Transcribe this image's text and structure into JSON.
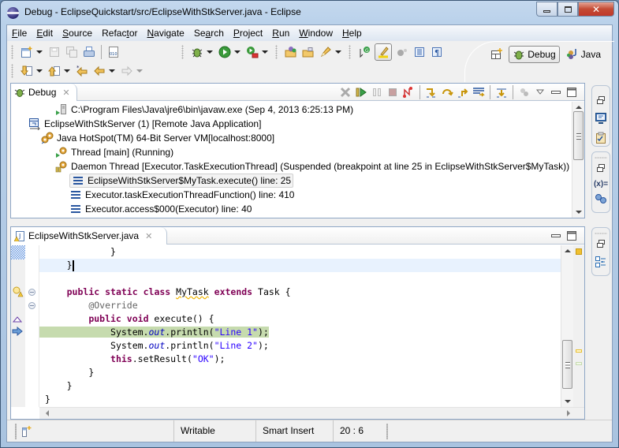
{
  "window": {
    "title": "Debug - EclipseQuickstart/src/EclipseWithStkServer.java - Eclipse",
    "controls": {
      "minimize": "minimize",
      "maximize": "maximize",
      "close": "close"
    }
  },
  "menu": [
    {
      "label": "File",
      "mnemonic": "F"
    },
    {
      "label": "Edit",
      "mnemonic": "E"
    },
    {
      "label": "Source",
      "mnemonic": "S"
    },
    {
      "label": "Refactor",
      "mnemonic": "t"
    },
    {
      "label": "Navigate",
      "mnemonic": "N"
    },
    {
      "label": "Search",
      "mnemonic": "a"
    },
    {
      "label": "Project",
      "mnemonic": "P"
    },
    {
      "label": "Run",
      "mnemonic": "R"
    },
    {
      "label": "Window",
      "mnemonic": "W"
    },
    {
      "label": "Help",
      "mnemonic": "H"
    }
  ],
  "toolbar": {
    "row1": [
      "new-wizard-icon",
      "save-icon",
      "save-all-icon",
      "print-icon",
      "binary-icon",
      "debug-icon",
      "run-icon",
      "external-tools-icon",
      "open-type-icon",
      "open-task-icon",
      "highlighter-icon",
      "toggle-breakpoint-icon",
      "mark-occurrences-icon",
      "block-selection-icon",
      "show-whitespace-icon",
      "paragraph-icon"
    ],
    "row2": [
      "next-annotation-icon",
      "previous-annotation-icon",
      "last-edit-icon",
      "back-icon",
      "forward-icon"
    ]
  },
  "perspectives": {
    "open_label": "open-perspective",
    "items": [
      {
        "label": "Debug",
        "active": true
      },
      {
        "label": "Java",
        "active": false
      }
    ]
  },
  "debug_view": {
    "tab_label": "Debug",
    "tree": [
      {
        "level": 2,
        "icon": "process-icon",
        "text": "C:\\Program Files\\Java\\jre6\\bin\\javaw.exe (Sep 4, 2013 6:25:13 PM)"
      },
      {
        "level": 0,
        "icon": "launch-icon",
        "text": "EclipseWithStkServer (1) [Remote Java Application]"
      },
      {
        "level": 1,
        "icon": "vm-icon",
        "text": "Java HotSpot(TM) 64-Bit Server VM[localhost:8000]"
      },
      {
        "level": 2,
        "icon": "thread-running-icon",
        "text": "Thread [main] (Running)"
      },
      {
        "level": 2,
        "icon": "thread-suspended-icon",
        "text": "Daemon Thread [Executor.TaskExecutionThread] (Suspended (breakpoint at line 25 in EclipseWithStkServer$MyTask))"
      },
      {
        "level": 3,
        "icon": "stack-frame-icon",
        "text": "EclipseWithStkServer$MyTask.execute() line: 25",
        "selected": true
      },
      {
        "level": 3,
        "icon": "stack-frame-icon",
        "text": "Executor.taskExecutionThreadFunction() line: 410"
      },
      {
        "level": 3,
        "icon": "stack-frame-icon",
        "text": "Executor.access$000(Executor) line: 40"
      }
    ]
  },
  "editor": {
    "tab_label": "EclipseWithStkServer.java",
    "lines": [
      {
        "indent": "            ",
        "tokens": [
          {
            "t": "}",
            "c": ""
          }
        ]
      },
      {
        "indent": "    ",
        "tokens": [
          {
            "t": "}",
            "c": ""
          }
        ],
        "current": true,
        "caret": true
      },
      {
        "indent": "",
        "tokens": []
      },
      {
        "indent": "    ",
        "tokens": [
          {
            "t": "public",
            "c": "kw"
          },
          {
            "t": " ",
            "c": ""
          },
          {
            "t": "static",
            "c": "kw"
          },
          {
            "t": " ",
            "c": ""
          },
          {
            "t": "class",
            "c": "kw"
          },
          {
            "t": " ",
            "c": ""
          },
          {
            "t": "MyTask",
            "c": "squig"
          },
          {
            "t": " ",
            "c": ""
          },
          {
            "t": "extends",
            "c": "kw"
          },
          {
            "t": " Task {",
            "c": ""
          }
        ]
      },
      {
        "indent": "        ",
        "tokens": [
          {
            "t": "@Override",
            "c": "ann"
          }
        ]
      },
      {
        "indent": "        ",
        "tokens": [
          {
            "t": "public",
            "c": "kw"
          },
          {
            "t": " ",
            "c": ""
          },
          {
            "t": "void",
            "c": "kw"
          },
          {
            "t": " execute() {",
            "c": ""
          }
        ]
      },
      {
        "indent": "            ",
        "tokens": [
          {
            "t": "System.",
            "c": ""
          },
          {
            "t": "out",
            "c": "fld"
          },
          {
            "t": ".println(",
            "c": ""
          },
          {
            "t": "\"Line 1\"",
            "c": "str"
          },
          {
            "t": ");",
            "c": ""
          }
        ],
        "highlight": true
      },
      {
        "indent": "            ",
        "tokens": [
          {
            "t": "System.",
            "c": ""
          },
          {
            "t": "out",
            "c": "fld"
          },
          {
            "t": ".println(",
            "c": ""
          },
          {
            "t": "\"Line 2\"",
            "c": "str"
          },
          {
            "t": ");",
            "c": ""
          }
        ]
      },
      {
        "indent": "            ",
        "tokens": [
          {
            "t": "this",
            "c": "kw"
          },
          {
            "t": ".setResult(",
            "c": ""
          },
          {
            "t": "\"OK\"",
            "c": "str"
          },
          {
            "t": ");",
            "c": ""
          }
        ]
      },
      {
        "indent": "        ",
        "tokens": [
          {
            "t": "}",
            "c": ""
          }
        ]
      },
      {
        "indent": "    ",
        "tokens": [
          {
            "t": "}",
            "c": ""
          }
        ]
      },
      {
        "indent": "",
        "tokens": [
          {
            "t": "}",
            "c": ""
          }
        ]
      }
    ]
  },
  "status_bar": {
    "mode": "Writable",
    "insert_mode": "Smart Insert",
    "position": "20 : 6"
  },
  "colors": {
    "keyword": "#7f0055",
    "string": "#2a00ff",
    "annotation": "#646464",
    "field": "#0000c0",
    "current_instruction": "#c6dbae",
    "current_line": "#e8f2fe"
  }
}
